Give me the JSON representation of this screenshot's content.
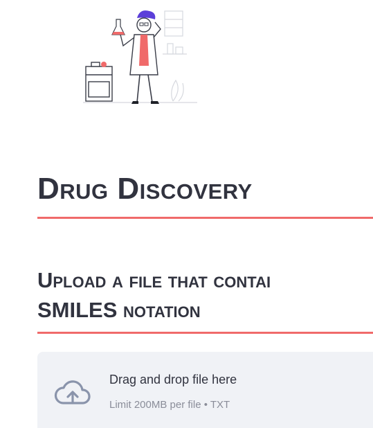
{
  "page": {
    "title": "Drug Discovery",
    "subtitle_line1": "Upload a file that contai",
    "subtitle_line2": "SMILES notation"
  },
  "uploader": {
    "drag_text": "Drag and drop file here",
    "limit_text": "Limit 200MB per file • TXT",
    "icon": "cloud-upload-icon"
  },
  "colors": {
    "accent": "#f06a6a",
    "text": "#31333f",
    "dropzone_bg": "#f0f2f6",
    "icon": "#8a94ab"
  }
}
